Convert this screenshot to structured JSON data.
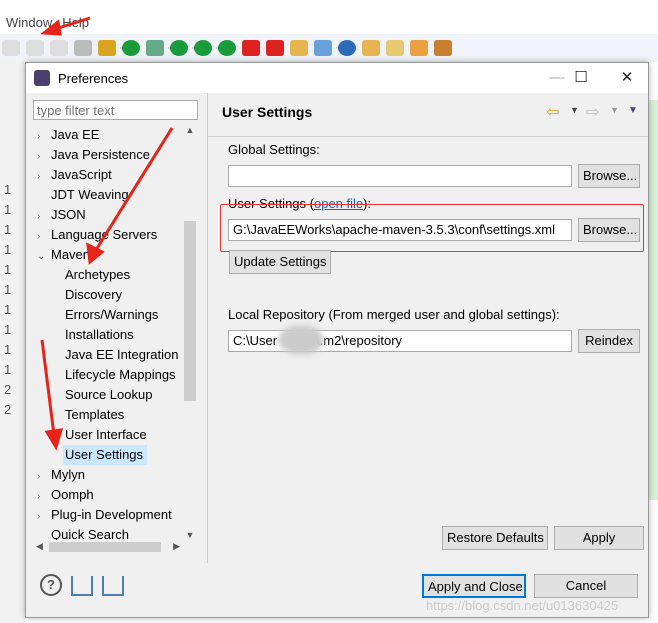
{
  "menu": [
    "Window",
    "Help"
  ],
  "gutter": [
    "1",
    "1",
    "1",
    "1",
    "1",
    "1",
    "1",
    "1",
    "1",
    "1",
    "2",
    "2"
  ],
  "dialog": {
    "title": "Preferences",
    "minimize": "—",
    "maximize": "☐",
    "close": "✕"
  },
  "filter": {
    "placeholder": "type filter text"
  },
  "tree": [
    {
      "label": "Java EE",
      "level": 0,
      "tw": "›"
    },
    {
      "label": "Java Persistence",
      "level": 0,
      "tw": "›"
    },
    {
      "label": "JavaScript",
      "level": 0,
      "tw": "›"
    },
    {
      "label": "JDT Weaving",
      "level": 0,
      "tw": ""
    },
    {
      "label": "JSON",
      "level": 0,
      "tw": "›"
    },
    {
      "label": "Language Servers",
      "level": 0,
      "tw": "›"
    },
    {
      "label": "Maven",
      "level": 0,
      "tw": "⌄"
    },
    {
      "label": "Archetypes",
      "level": 1
    },
    {
      "label": "Discovery",
      "level": 1
    },
    {
      "label": "Errors/Warnings",
      "level": 1
    },
    {
      "label": "Installations",
      "level": 1
    },
    {
      "label": "Java EE Integration",
      "level": 1
    },
    {
      "label": "Lifecycle Mappings",
      "level": 1
    },
    {
      "label": "Source Lookup",
      "level": 1
    },
    {
      "label": "Templates",
      "level": 1
    },
    {
      "label": "User Interface",
      "level": 1
    },
    {
      "label": "User Settings",
      "level": 1,
      "selected": true
    },
    {
      "label": "Mylyn",
      "level": 0,
      "tw": "›"
    },
    {
      "label": "Oomph",
      "level": 0,
      "tw": "›"
    },
    {
      "label": "Plug-in Development",
      "level": 0,
      "tw": "›"
    },
    {
      "label": "Quick Search",
      "level": 0,
      "tw": ""
    }
  ],
  "page": {
    "title": "User Settings",
    "global_label": "Global Settings:",
    "global_value": "",
    "browse": "Browse...",
    "user_label_pre": "User Settings (",
    "user_link": "open file",
    "user_label_post": "):",
    "user_value": "G:\\JavaEEWorks\\apache-maven-3.5.3\\conf\\settings.xml",
    "update": "Update Settings",
    "local_label": "Local Repository (From merged user and global settings):",
    "local_value": "C:\\User   \\.m2\\repository",
    "reindex": "Reindex",
    "restore": "Restore Defaults",
    "apply": "Apply"
  },
  "footer": {
    "apply_close": "Apply and Close",
    "cancel": "Cancel",
    "watermark": "https://blog.csdn.net/u013630425"
  },
  "colors": {
    "annotation": "#e8241a",
    "selection": "#cce8ff",
    "link": "#0066cc"
  }
}
